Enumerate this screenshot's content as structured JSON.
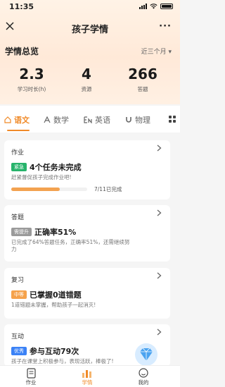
{
  "status_bar": {
    "time": "11:35"
  },
  "header": {
    "title": "孩子学情",
    "close_icon": "close-icon",
    "more_label": "···"
  },
  "overview": {
    "title": "学情总览",
    "period": "近三个月",
    "stats": [
      {
        "value": "2.3",
        "label": "学习时长(h)"
      },
      {
        "value": "4",
        "label": "资源"
      },
      {
        "value": "266",
        "label": "答题"
      }
    ]
  },
  "subject_tabs": [
    {
      "label": "语文",
      "icon": "home-icon",
      "active": true
    },
    {
      "label": "数学",
      "icon": "math-icon",
      "active": false
    },
    {
      "label": "英语",
      "icon": "english-icon",
      "active": false
    },
    {
      "label": "物理",
      "icon": "magnet-icon",
      "active": false
    }
  ],
  "cards": {
    "homework": {
      "title": "作业",
      "tag": "紧急",
      "tag_color": "#27b36b",
      "main": "4个任务未完成",
      "sub": "赶紧督促孩子完成作业吧!",
      "progress_label": "7/11已完成",
      "progress_fraction": 0.636
    },
    "quiz": {
      "title": "答题",
      "tag": "需提升",
      "tag_color": "#9a9a9a",
      "main": "正确率51%",
      "sub": "已完成了64%答题任务，正确率51%，还需继续努力"
    },
    "review": {
      "title": "复习",
      "tag": "中等",
      "tag_color": "#f5a24b",
      "main": "已掌握0道错题",
      "sub": "1道错题未掌握，帮助孩子一起消灭!"
    },
    "interact": {
      "title": "互动",
      "tag": "优秀",
      "tag_color": "#3b82f6",
      "main": "参与互动79次",
      "sub": "孩子在课堂上积极参与，表现活跃，棒极了!"
    }
  },
  "bottom_nav": [
    {
      "label": "作业",
      "icon": "homework-icon",
      "active": false
    },
    {
      "label": "学情",
      "icon": "bar-chart-icon",
      "active": true
    },
    {
      "label": "我的",
      "icon": "profile-icon",
      "active": false
    }
  ],
  "colors": {
    "accent": "#f08a28",
    "header_bg": "#ffe9d8"
  }
}
